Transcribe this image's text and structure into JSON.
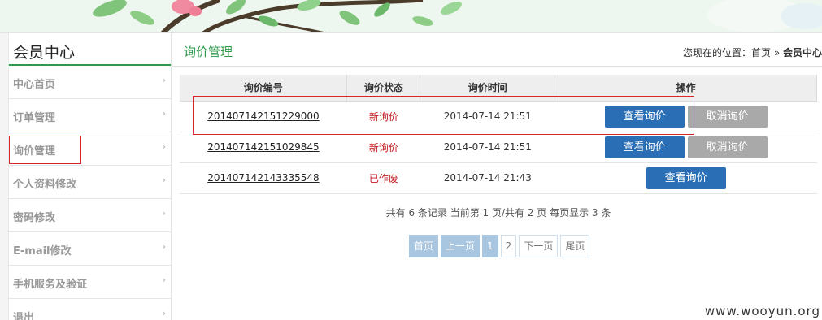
{
  "sidebar": {
    "title": "会员中心",
    "items": [
      {
        "label": "中心首页"
      },
      {
        "label": "订单管理"
      },
      {
        "label": "询价管理"
      },
      {
        "label": "个人资料修改"
      },
      {
        "label": "密码修改"
      },
      {
        "label": "E-mail修改"
      },
      {
        "label": "手机服务及验证"
      },
      {
        "label": "退出"
      }
    ],
    "chevron": "›"
  },
  "header": {
    "page_title": "询价管理",
    "breadcrumb_prefix": "您现在的位置：首页 » ",
    "breadcrumb_current": "会员中心"
  },
  "table": {
    "columns": [
      "询价编号",
      "询价状态",
      "询价时间",
      "操作"
    ],
    "rows": [
      {
        "id": "201407142151229000",
        "status": "新询价",
        "time": "2014-07-14 21:51",
        "view": "查看询价",
        "cancel": "取消询价"
      },
      {
        "id": "201407142151029845",
        "status": "新询价",
        "time": "2014-07-14 21:51",
        "view": "查看询价",
        "cancel": "取消询价"
      },
      {
        "id": "201407142143335548",
        "status": "已作废",
        "time": "2014-07-14 21:43",
        "view": "查看询价"
      }
    ]
  },
  "summary": "共有 6 条记录 当前第 1 页/共有 2 页 每页显示 3 条",
  "pager": {
    "first": "首页",
    "prev": "上一页",
    "page1": "1",
    "page2": "2",
    "next": "下一页",
    "last": "尾页"
  },
  "watermark": "www.wooyun.org",
  "colors": {
    "accent_green": "#2c9a49",
    "button_blue": "#2a6fb5",
    "button_gray": "#a9a9a9",
    "status_red": "#c0161c",
    "highlight_red": "#d9242b"
  }
}
